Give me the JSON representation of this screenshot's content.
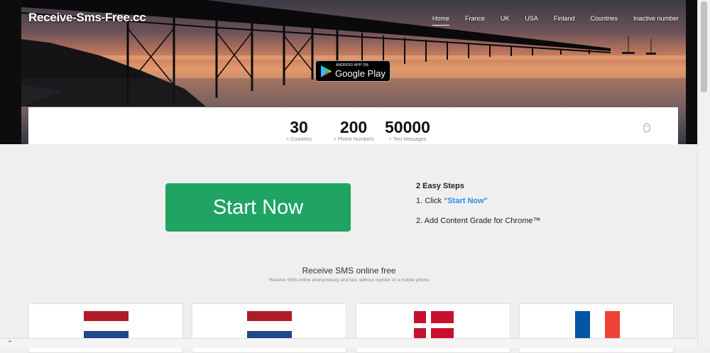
{
  "header": {
    "logo": "Receive-Sms-Free.cc",
    "nav": [
      {
        "label": "Home",
        "active": true
      },
      {
        "label": "France"
      },
      {
        "label": "UK"
      },
      {
        "label": "USA"
      },
      {
        "label": "Finland"
      },
      {
        "label": "Countries"
      },
      {
        "label": "Inactive number"
      }
    ],
    "play_badge": {
      "small": "ANDROID APP ON",
      "big": "Google Play"
    }
  },
  "stats": [
    {
      "value": "30",
      "label": "+ Countries"
    },
    {
      "value": "200",
      "label": "+ Phone Numbers"
    },
    {
      "value": "50000",
      "label": "+ Text Messages"
    }
  ],
  "cta": {
    "label": "Start Now"
  },
  "steps": {
    "title": "2 Easy Steps",
    "step1_prefix": "1. Click ",
    "step1_link": "\"Start Now\"",
    "step2": "2. Add Content Grade for Chrome™"
  },
  "section": {
    "title": "Receive SMS online free",
    "subtitle": "Receive SMS online anonymously and fast, without register or a mobile phone"
  },
  "cards": [
    {
      "flag": "netherlands-flag"
    },
    {
      "flag": "netherlands-flag"
    },
    {
      "flag": "denmark-flag"
    },
    {
      "flag": "france-flag"
    }
  ],
  "colors": {
    "accent_green": "#1fa463",
    "link_blue": "#2e8ce6",
    "nl_red": "#ae1c28",
    "nl_blue": "#21468b",
    "dk_red": "#c8102e",
    "fr_blue": "#0055a4",
    "fr_red": "#ef4135"
  }
}
